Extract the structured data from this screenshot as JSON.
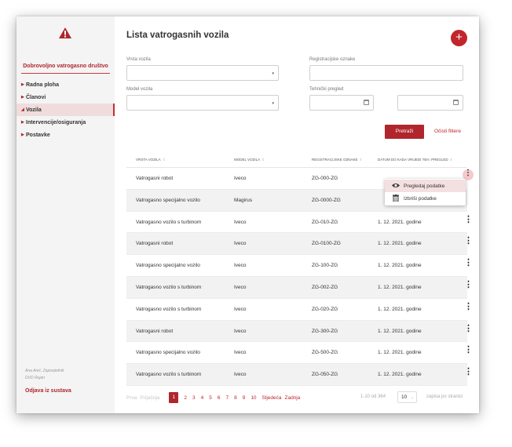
{
  "sidebar": {
    "org_name": "Dobrovoljno vatrogasno društvo",
    "items": [
      {
        "label": "Radna ploha",
        "active": false
      },
      {
        "label": "Članovi",
        "active": false
      },
      {
        "label": "Vozila",
        "active": true
      },
      {
        "label": "Intervencije/osiguranja",
        "active": false
      },
      {
        "label": "Postavke",
        "active": false
      }
    ],
    "user_name": "Ana Anić, Zapovjednik",
    "user_org": "DVD Rujan",
    "logout": "Odjava iz sustava"
  },
  "header": {
    "title": "Lista vatrogasnih vozila",
    "add_label": "+"
  },
  "filters": {
    "vehicle_type_label": "Vrsta vozila",
    "registration_label": "Registracijske oznake",
    "model_label": "Model vozila",
    "inspection_label": "Tehnički pregled",
    "search_label": "Pretraži",
    "clear_label": "Očisti filtere"
  },
  "table": {
    "columns": [
      "Vrsta vozila",
      "Model vozila",
      "Registracijske oznake",
      "Datum do kada vrijedi teh. pregled"
    ],
    "rows": [
      [
        "Vatrogasni robot",
        "Iveco",
        "ZG-000-ZG",
        ""
      ],
      [
        "Vatrogasno specijalno vozilo",
        "Magirus",
        "ZG-0000-ZG",
        ""
      ],
      [
        "Vatrogasno vozilo s turbinom",
        "Iveco",
        "ZG-010-ZG",
        "1. 12. 2021. godine"
      ],
      [
        "Vatrogasni robot",
        "Iveco",
        "ZG-0100-ZG",
        "1. 12. 2021. godine"
      ],
      [
        "Vatrogasno specijalno vozilo",
        "Iveco",
        "ZG-100-ZG",
        "1. 12. 2021. godine"
      ],
      [
        "Vatrogasno vozilo s turbinom",
        "Iveco",
        "ZG-002-ZG",
        "1. 12. 2021. godine"
      ],
      [
        "Vatrogasno vozilo s turbinom",
        "Iveco",
        "ZG-020-ZG",
        "1. 12. 2021. godine"
      ],
      [
        "Vatrogasni robot",
        "Iveco",
        "ZG-300-ZG",
        "1. 12. 2021. godine"
      ],
      [
        "Vatrogasno specijalno vozilo",
        "Iveco",
        "ZG-500-ZG",
        "1. 12. 2021. godine"
      ],
      [
        "Vatrogasno vozilo s turbinom",
        "Iveco",
        "ZG-050-ZG",
        "1. 12. 2021. godine"
      ]
    ]
  },
  "context_menu": {
    "view_label": "Pregledaj podatke",
    "delete_label": "Izbriši podatke"
  },
  "pagination": {
    "first": "Prva",
    "prev": "Prijašnja",
    "pages": [
      "1",
      "2",
      "3",
      "4",
      "5",
      "6",
      "7",
      "8",
      "9",
      "10"
    ],
    "current": "1",
    "next": "Sljedeća",
    "last": "Zadnja",
    "range": "1-10 od 364",
    "per_page": "10",
    "per_page_label": "zapisa po stranici"
  },
  "colors": {
    "accent": "#b0262c",
    "active_bg": "#f1dcdd"
  },
  "icons": [
    "warning-icon",
    "plus-icon",
    "chevron-down-icon",
    "calendar-icon",
    "sort-icon",
    "more-vertical-icon",
    "eye-icon",
    "trash-icon"
  ]
}
